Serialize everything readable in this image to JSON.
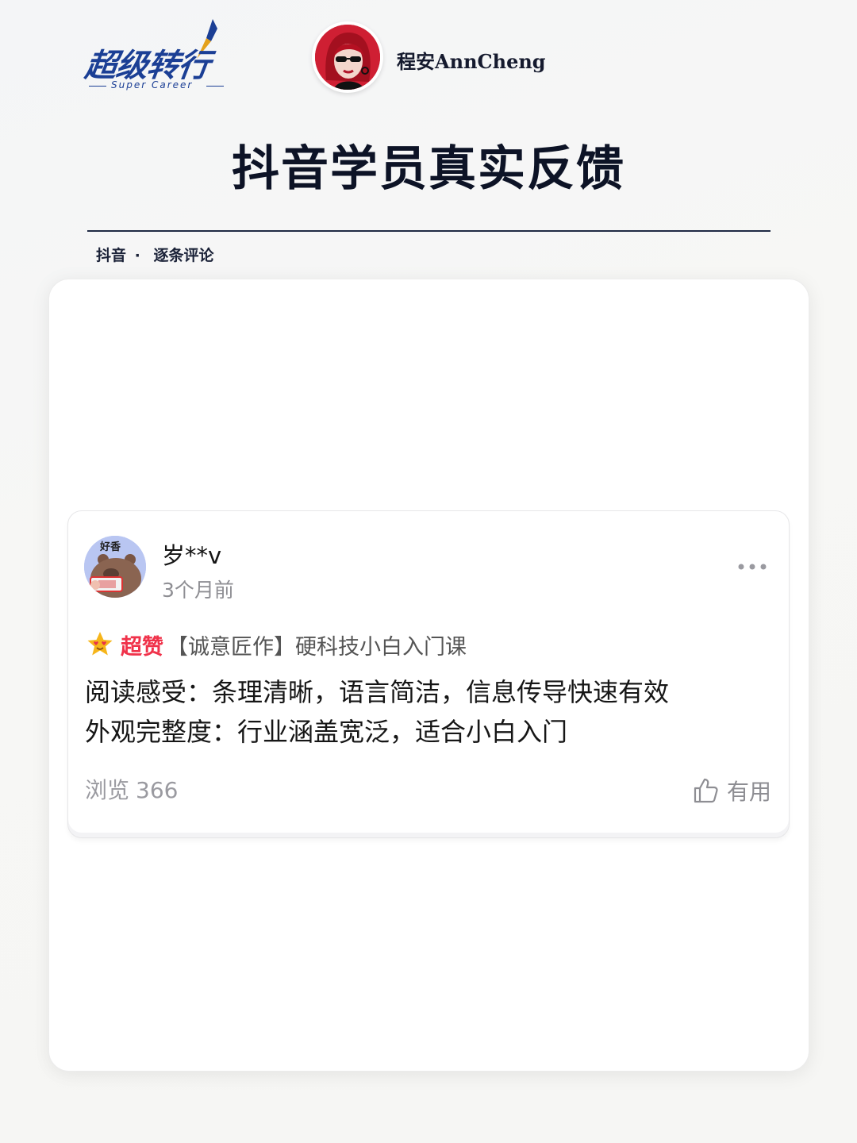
{
  "brand": {
    "logo_text": "超级转行",
    "logo_subtext": "Super Career",
    "colors": {
      "logo": "#1b3f95",
      "accent_red": "#f0324a"
    }
  },
  "author": {
    "name": "程安AnnCheng",
    "avatar_icon": "woman-sunglasses-avatar"
  },
  "page": {
    "title": "抖音学员真实反馈"
  },
  "subnav": {
    "platform": "抖音",
    "separator": "·",
    "mode": "逐条评论"
  },
  "comment": {
    "username": "岁**v",
    "time": "3个月前",
    "avatar_icon": "bear-avatar",
    "avatar_badge": "好香",
    "more_icon": "more-icon",
    "tag_icon": "star-eyes-icon",
    "tag": "超赞",
    "course": "【诚意匠作】硬科技小白入门课",
    "lines": [
      "阅读感受：条理清晰，语言简洁，信息传导快速有效",
      "外观完整度：行业涵盖宽泛，适合小白入门"
    ],
    "views_label": "浏览",
    "views_count": "366",
    "useful_label": "有用",
    "useful_icon": "thumbs-up-icon"
  }
}
